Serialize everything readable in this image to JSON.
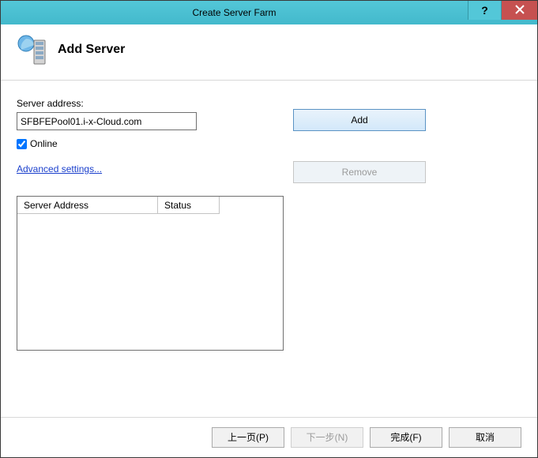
{
  "window": {
    "title": "Create Server Farm"
  },
  "header": {
    "title": "Add Server"
  },
  "form": {
    "server_address_label": "Server address:",
    "server_address_value": "SFBFEPool01.i-x-Cloud.com",
    "online_label": "Online",
    "online_checked": true,
    "advanced_link": "Advanced settings..."
  },
  "buttons": {
    "add": "Add",
    "remove": "Remove"
  },
  "table": {
    "columns": [
      "Server Address",
      "Status"
    ],
    "rows": []
  },
  "footer": {
    "prev": "上一页(P)",
    "next": "下一步(N)",
    "finish": "完成(F)",
    "cancel": "取消"
  }
}
